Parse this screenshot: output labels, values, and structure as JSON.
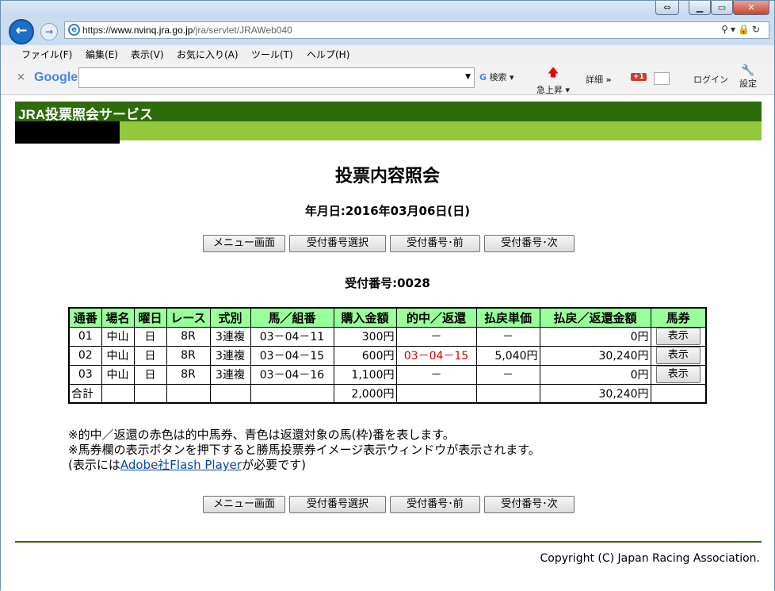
{
  "browser": {
    "url_scheme": "https://",
    "url_host": "www.nvinq.jra.go.jp",
    "url_path": "/jra/servlet/JRAWeb040",
    "menu": [
      "ファイル(F)",
      "編集(E)",
      "表示(V)",
      "お気に入り(A)",
      "ツール(T)",
      "ヘルプ(H)"
    ],
    "google_logo": "Google",
    "toolbar": {
      "search": "検索",
      "rising": "急上昇",
      "details": "詳細",
      "more": "»",
      "gplus": "+1",
      "login": "ログイン",
      "settings": "設定"
    }
  },
  "site": {
    "header": "JRA投票照会サービス"
  },
  "page": {
    "title": "投票内容照会",
    "date_label": "年月日:",
    "date_value": "2016年03月06日(日)",
    "buttons": [
      "メニュー画面",
      "受付番号選択",
      "受付番号･前",
      "受付番号･次"
    ],
    "receipt_label": "受付番号:",
    "receipt_value": "0028"
  },
  "table": {
    "headers": [
      "通番",
      "場名",
      "曜日",
      "レース",
      "式別",
      "馬／組番",
      "購入金額",
      "的中／返還",
      "払戻単価",
      "払戻／返還金額",
      "馬券"
    ],
    "rows": [
      [
        "01",
        "中山",
        "日",
        "8R",
        "3連複",
        "03－04－11",
        "300円",
        "－",
        "－",
        "0円",
        "表示"
      ],
      [
        "02",
        "中山",
        "日",
        "8R",
        "3連複",
        "03－04－15",
        "600円",
        "03－04－15",
        "5,040円",
        "30,240円",
        "表示"
      ],
      [
        "03",
        "中山",
        "日",
        "8R",
        "3連複",
        "03－04－16",
        "1,100円",
        "－",
        "－",
        "0円",
        "表示"
      ]
    ],
    "total": {
      "label": "合計",
      "purchase": "2,000円",
      "payout": "30,240円"
    }
  },
  "notes": {
    "line1": "※的中／返還の赤色は的中馬券、青色は返還対象の馬(枠)番を表します。",
    "line2": "※馬券欄の表示ボタンを押下すると勝馬投票券イメージ表示ウィンドウが表示されます。",
    "line3_pre": "(表示には",
    "line3_link": "Adobe社Flash Player",
    "line3_post": "が必要です)"
  },
  "footer": {
    "copyright": "Copyright (C) Japan Racing Association."
  },
  "colors": {
    "header_dark_green": "#2e6b0b",
    "header_light_green": "#92c83a",
    "table_header_bg": "#99ff99",
    "hit_red": "#e00000",
    "link_blue": "#0645ad"
  }
}
